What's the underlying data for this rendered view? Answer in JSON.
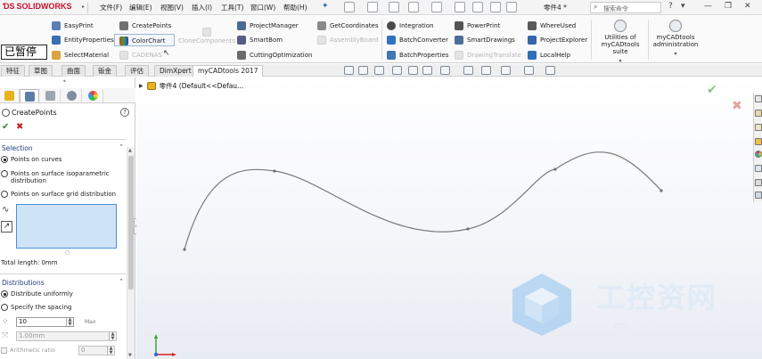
{
  "app": {
    "logo_ds": "ƊS",
    "logo_name": "SOLIDWORKS",
    "document_name": "零件4 *",
    "search_placeholder": "搜索命令"
  },
  "menu": [
    {
      "label": "文件(F)"
    },
    {
      "label": "编辑(E)"
    },
    {
      "label": "视图(V)"
    },
    {
      "label": "插入(I)"
    },
    {
      "label": "工具(T)"
    },
    {
      "label": "窗口(W)"
    },
    {
      "label": "帮助(H)"
    }
  ],
  "ime_chip": "已暂停",
  "ribbon": {
    "col1": [
      "EasyPrint",
      "EntityProperties",
      "SelectMaterial"
    ],
    "col2": [
      "CreatePoints",
      "ColorChart",
      "CADENAS"
    ],
    "clone_components": "CloneComponents",
    "col3": [
      "ProjectManager",
      "SmartBom",
      "CuttingOptimization"
    ],
    "col4": [
      "GetCoordinates",
      "AssemblyBoard"
    ],
    "col5": [
      "Integration",
      "BatchConverter",
      "BatchProperties"
    ],
    "col6": [
      "PowerPrint",
      "SmartDrawings",
      "DrawingTranslate"
    ],
    "col7": [
      "WhereUsed",
      "ProjectExplorer",
      "LocalHelp"
    ],
    "utilities": "Utilities of myCADtools suite",
    "administration": "myCADtools administration"
  },
  "tabs": [
    "特征",
    "草图",
    "曲面",
    "钣金",
    "评估",
    "DimXpert",
    "myCADtools 2017"
  ],
  "active_tab": "myCADtools 2017",
  "property_manager": {
    "title": "CreatePoints",
    "selection_header": "Selection",
    "options": [
      {
        "label": "Points on curves",
        "selected": true
      },
      {
        "label": "Points on surface isoparametric distribution",
        "selected": false
      },
      {
        "label": "Points on surface grid distribution",
        "selected": false
      }
    ],
    "total_length": "Total length: 0mm",
    "distributions_header": "Distributions",
    "dist_options": [
      {
        "label": "Distribute uniformly",
        "selected": true
      },
      {
        "label": "Specify the spacing",
        "selected": false
      }
    ],
    "count_value": "10",
    "count_max_label": "Max",
    "spacing_value": "1.00mm",
    "arithmetic_ratio_label": "Arithmetic ratio",
    "ratio_value": "0"
  },
  "graphics": {
    "tree_label": "零件4  (Default<<Defau..."
  },
  "watermark": {
    "main": "工控资网",
    "sub": "om"
  },
  "colors": {
    "brand": "#c8102e",
    "curve": "#7a7a7a",
    "selection_box": "#cfe3f7",
    "group_header": "#1f3f7a"
  }
}
